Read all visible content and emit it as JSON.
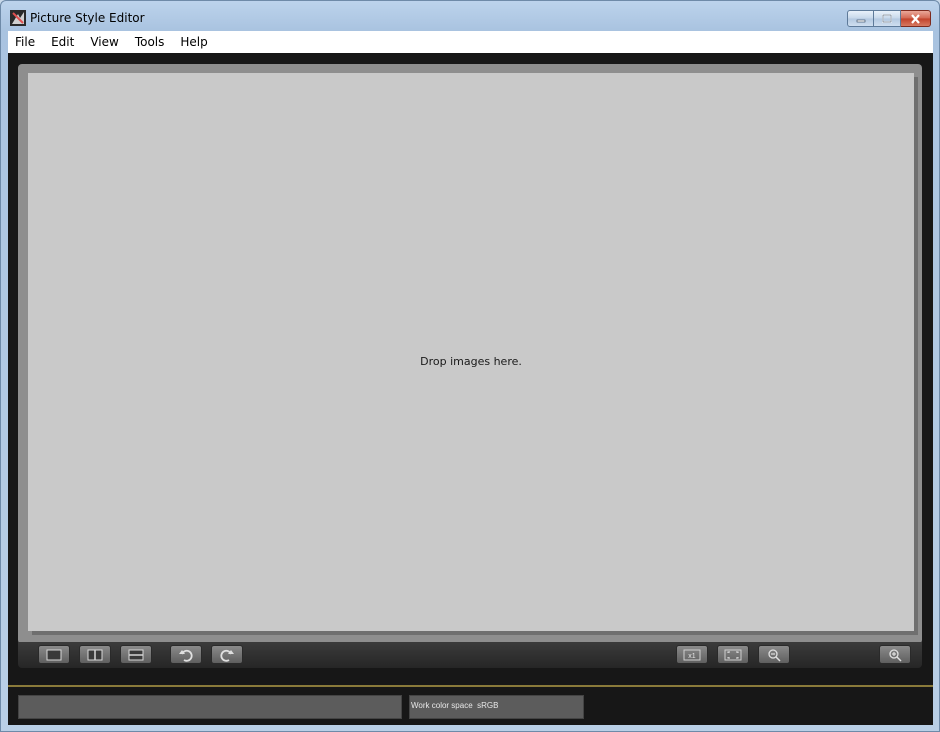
{
  "window": {
    "title": "Picture Style Editor",
    "controls": [
      "minimize-icon",
      "restore-icon",
      "close-icon"
    ]
  },
  "menu": {
    "items": [
      {
        "label": "File"
      },
      {
        "label": "Edit"
      },
      {
        "label": "View"
      },
      {
        "label": "Tools"
      },
      {
        "label": "Help"
      }
    ]
  },
  "viewer": {
    "placeholder": "Drop images here."
  },
  "toolbar": {
    "left_buttons": [
      "single-view-icon",
      "side-by-side-view-icon",
      "top-bottom-view-icon",
      "rotate-left-icon",
      "rotate-right-icon"
    ],
    "right_buttons": [
      "actual-size-icon",
      "fit-to-window-icon",
      "zoom-out-icon",
      "zoom-in-icon"
    ],
    "actual_size_label": "x1"
  },
  "status": {
    "left_text": "",
    "color_space": "Work color space  sRGB"
  },
  "colors": {
    "background": "#171717",
    "canvas": "#c9c9c9",
    "accent_line": "#8a7a3a"
  }
}
